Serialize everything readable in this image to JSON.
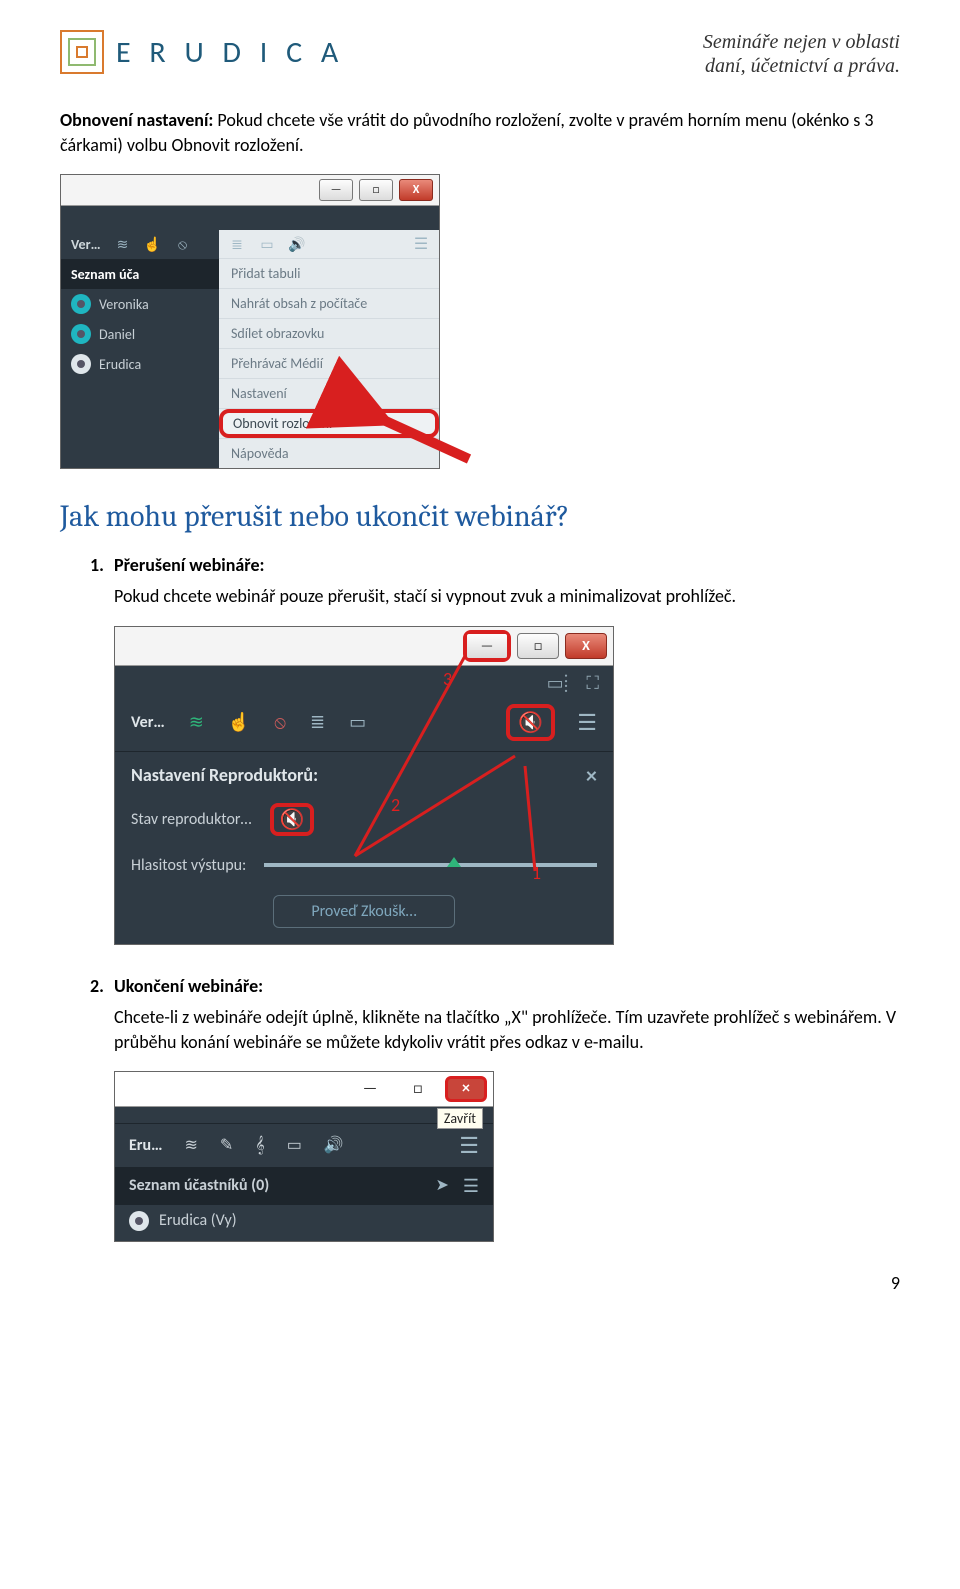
{
  "header": {
    "brand": "E R U D I C A",
    "tagline_line1": "Semináře nejen v oblasti",
    "tagline_line2": "daní, účetnictví a práva."
  },
  "section_reset": {
    "lead_bold": "Obnovení nastavení:",
    "lead_rest": " Pokud chcete vše vrátit do původního rozložení, zvolte v pravém horním menu (okénko s 3 čárkami) volbu Obnovit rozložení."
  },
  "fig1": {
    "win_minimize": "—",
    "win_maximize": "□",
    "win_close": "X",
    "ver": "Ver…",
    "panel_header": "Seznam úča",
    "participants": [
      "Veronika",
      "Daniel",
      "Erudica"
    ],
    "menu": {
      "add_board": "Přidat tabuli",
      "upload": "Nahrát obsah z počítače",
      "share": "Sdílet obrazovku",
      "player": "Přehrávač Médií",
      "settings": "Nastavení",
      "reset_layout": "Obnovit rozložení",
      "help": "Nápověda"
    }
  },
  "h2": "Jak mohu přerušit nebo ukončit webinář?",
  "item1": {
    "num": "1.",
    "title": "Přerušení webináře:",
    "body": "Pokud chcete webinář pouze přerušit, stačí si vypnout zvuk a minimalizovat prohlížeč."
  },
  "fig2": {
    "win_minimize": "—",
    "win_maximize": "□",
    "win_close": "X",
    "ver": "Ver…",
    "panel_title": "Nastavení Reproduktorů:",
    "row_state": "Stav reproduktor…",
    "row_volume": "Hlasitost výstupu:",
    "test_btn": "Proveď Zkoušk…",
    "n1": "1",
    "n2": "2",
    "n3": "3"
  },
  "item2": {
    "num": "2.",
    "title": "Ukončení webináře:",
    "body": "Chcete-li z webináře odejít úplně, klikněte na tlačítko „X\" prohlížeče. Tím uzavřete prohlížeč s webinářem. V průběhu konání webináře se můžete kdykoliv vrátit přes odkaz v e-mailu."
  },
  "fig3": {
    "win_minimize": "—",
    "win_maximize": "□",
    "win_close": "×",
    "tooltip": "Zavřít",
    "eru": "Eru…",
    "panel_title": "Seznam účastníků (0)",
    "row_name": "Erudica (Vy)"
  },
  "page_num": "9"
}
